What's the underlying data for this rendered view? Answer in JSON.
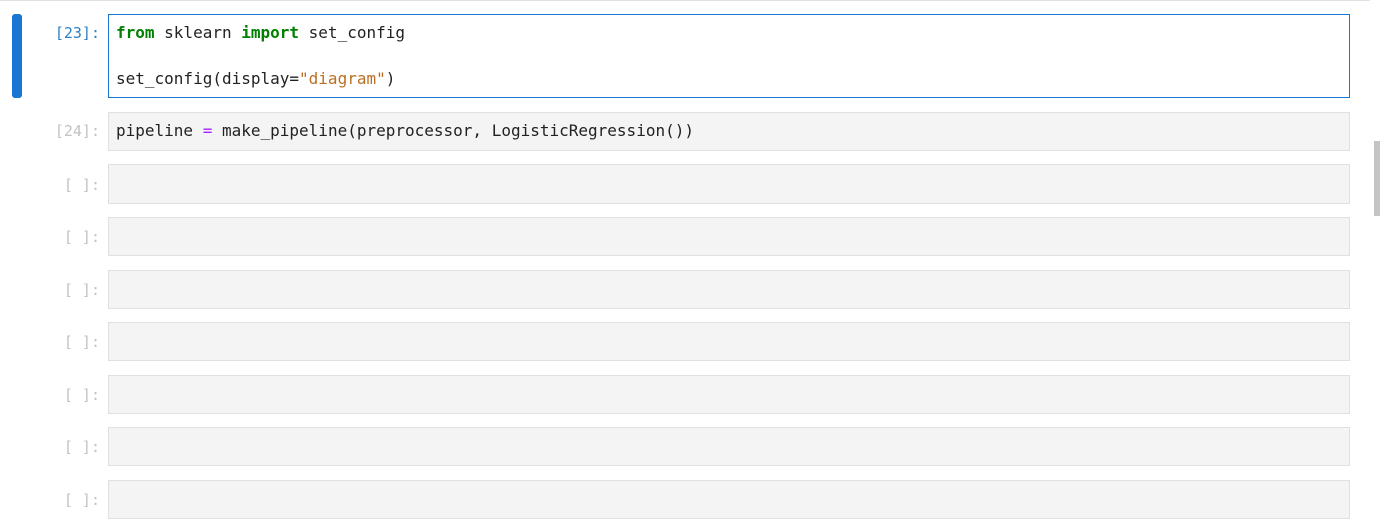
{
  "cells": [
    {
      "prompt": "[23]:",
      "active": true,
      "lines": [
        {
          "tokens": [
            {
              "text": "from",
              "kind": "kw"
            },
            {
              "text": " sklearn ",
              "kind": "plain"
            },
            {
              "text": "import",
              "kind": "kw"
            },
            {
              "text": " set_config",
              "kind": "plain"
            }
          ]
        },
        {
          "tokens": []
        },
        {
          "tokens": [
            {
              "text": "set_config(display=",
              "kind": "plain"
            },
            {
              "text": "\"diagram\"",
              "kind": "str"
            },
            {
              "text": ")",
              "kind": "plain"
            }
          ]
        }
      ]
    },
    {
      "prompt": "[24]:",
      "active": false,
      "lines": [
        {
          "tokens": [
            {
              "text": "pipeline ",
              "kind": "plain"
            },
            {
              "text": "=",
              "kind": "op"
            },
            {
              "text": " make_pipeline(preprocessor, LogisticRegression())",
              "kind": "plain"
            }
          ]
        }
      ]
    },
    {
      "prompt": "[ ]:",
      "active": false,
      "lines": []
    },
    {
      "prompt": "[ ]:",
      "active": false,
      "lines": []
    },
    {
      "prompt": "[ ]:",
      "active": false,
      "lines": []
    },
    {
      "prompt": "[ ]:",
      "active": false,
      "lines": []
    },
    {
      "prompt": "[ ]:",
      "active": false,
      "lines": []
    },
    {
      "prompt": "[ ]:",
      "active": false,
      "lines": []
    },
    {
      "prompt": "[ ]:",
      "active": false,
      "lines": []
    }
  ],
  "colors": {
    "active_border": "#1976d2",
    "prompt_active": "#307fc1",
    "prompt_inactive": "#c2c2c2",
    "keyword": "#008000",
    "operator": "#aa22ff",
    "string": "#ba6f24"
  }
}
